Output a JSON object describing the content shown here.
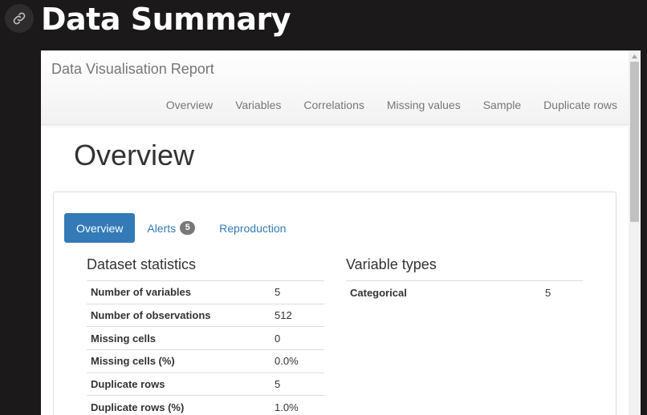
{
  "heading": "Data Summary",
  "icons": {
    "link": "link-icon",
    "scroll_up": "arrow-up-icon"
  },
  "report": {
    "brand": "Data Visualisation Report",
    "nav": [
      "Overview",
      "Variables",
      "Correlations",
      "Missing values",
      "Sample",
      "Duplicate rows"
    ],
    "section_title": "Overview",
    "tabs": {
      "overview": "Overview",
      "alerts": "Alerts",
      "alerts_count": "5",
      "reproduction": "Reproduction"
    },
    "dataset_statistics": {
      "title": "Dataset statistics",
      "rows": [
        {
          "label": "Number of variables",
          "value": "5"
        },
        {
          "label": "Number of observations",
          "value": "512"
        },
        {
          "label": "Missing cells",
          "value": "0"
        },
        {
          "label": "Missing cells (%)",
          "value": "0.0%"
        },
        {
          "label": "Duplicate rows",
          "value": "5"
        },
        {
          "label": "Duplicate rows (%)",
          "value": "1.0%"
        }
      ]
    },
    "variable_types": {
      "title": "Variable types",
      "rows": [
        {
          "label": "Categorical",
          "value": "5"
        }
      ]
    }
  },
  "colors": {
    "primary": "#337ab7",
    "dark_bg": "#1b191a",
    "badge": "#777777"
  }
}
